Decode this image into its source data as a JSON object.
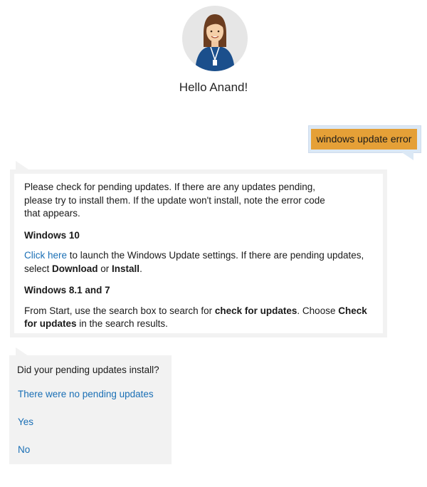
{
  "header": {
    "greeting": "Hello Anand!"
  },
  "user_message": {
    "text": "windows update error"
  },
  "bot_response": {
    "intro": "Please check for pending updates. If there are any updates pending, please try to install them. If the update won't install, note the error code that appears.",
    "section1": {
      "heading": "Windows 10",
      "link_text": "Click here",
      "text_1": " to launch the Windows Update settings. If there are pending updates, select ",
      "bold_1": "Download",
      "text_2": " or ",
      "bold_2": "Install",
      "text_3": "."
    },
    "section2": {
      "heading": "Windows 8.1 and 7",
      "text_1": "From Start, use the search box to search for ",
      "bold_1": "check for updates",
      "text_2": ". Choose ",
      "bold_2": "Check for updates",
      "text_3": " in the search results."
    }
  },
  "question": {
    "text": "Did your pending updates install?",
    "options": [
      "There were no pending updates",
      "Yes",
      "No"
    ]
  },
  "colors": {
    "accent_orange": "#e5a037",
    "link_blue": "#1a6fb5",
    "card_gray": "#f2f2f2",
    "user_bubble_bg": "#dbe8f5"
  }
}
